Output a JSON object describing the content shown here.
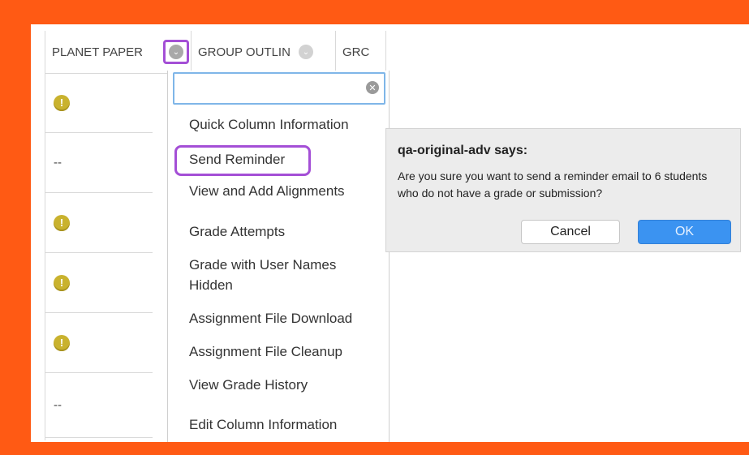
{
  "colors": {
    "frame": "#ff5a14",
    "highlight": "#a44fd6",
    "ok_button": "#3b93f1"
  },
  "grid": {
    "columns": [
      {
        "label": "PLANET PAPER",
        "icon": "chevron-down-icon"
      },
      {
        "label": "GROUP OUTLIN",
        "icon": "chevron-down-icon"
      },
      {
        "label": "GRC"
      }
    ],
    "rows": [
      {
        "type": "icon",
        "icon": "exclamation-icon",
        "glyph": "!"
      },
      {
        "type": "text",
        "text": "--"
      },
      {
        "type": "icon",
        "icon": "exclamation-icon",
        "glyph": "!"
      },
      {
        "type": "icon",
        "icon": "exclamation-icon",
        "glyph": "!"
      },
      {
        "type": "icon",
        "icon": "exclamation-icon",
        "glyph": "!"
      },
      {
        "type": "text",
        "text": "--"
      }
    ]
  },
  "menu": {
    "search_placeholder": "",
    "items": [
      {
        "label": "Quick Column Information"
      },
      {
        "label": "Send Reminder"
      },
      {
        "label": "View and Add Alignments"
      },
      {
        "label": "Grade Attempts"
      },
      {
        "label": "Grade with User Names"
      },
      {
        "label": "Hidden"
      },
      {
        "label": "Assignment File Download"
      },
      {
        "label": "Assignment File Cleanup"
      },
      {
        "label": "View Grade History"
      },
      {
        "label": "Edit Column Information"
      }
    ]
  },
  "dialog": {
    "title": "qa-original-adv says:",
    "message": "Are you sure you want to send a reminder email to 6 students who do not have a grade or submission?",
    "cancel_label": "Cancel",
    "ok_label": "OK"
  }
}
